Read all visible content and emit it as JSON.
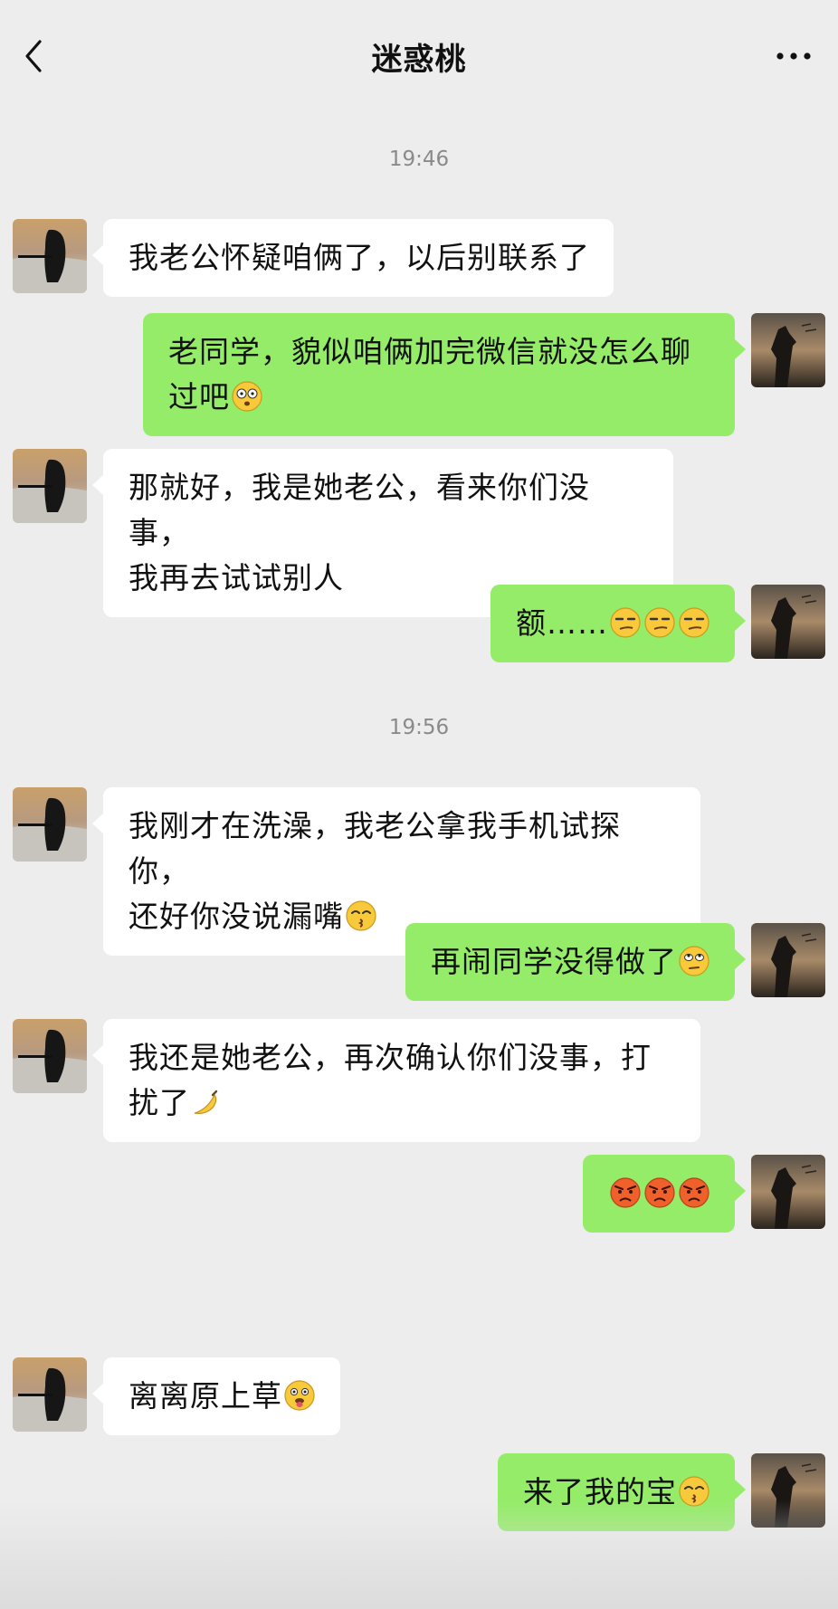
{
  "header": {
    "title": "迷惑桃",
    "back_icon": "chevron-left-icon",
    "more_icon": "more-dots-icon"
  },
  "colors": {
    "background": "#ededed",
    "incoming_bubble": "#ffffff",
    "outgoing_bubble": "#95ec69",
    "timestamp": "#8a8a8a"
  },
  "timestamps": [
    "19:46",
    "19:56"
  ],
  "messages": [
    {
      "side": "in",
      "lines": [
        "我老公怀疑咱俩了，以后别联系了"
      ]
    },
    {
      "side": "out",
      "line1": "老同学，貌似咱俩加完微信就没怎么聊",
      "line2": "过吧",
      "emoji": "shocked-face-icon"
    },
    {
      "side": "in",
      "line1": "那就好，我是她老公，看来你们没事，",
      "line2": "我再去试试别人"
    },
    {
      "side": "out",
      "text": "额……",
      "emojis": [
        "smirk-face-icon",
        "smirk-face-icon",
        "smirk-face-icon"
      ]
    },
    {
      "side": "in",
      "line1": "我刚才在洗澡，我老公拿我手机试探你，",
      "line2": "还好你没说漏嘴",
      "emoji": "kissing-face-icon"
    },
    {
      "side": "out",
      "text": "再闹同学没得做了",
      "emoji": "eye-roll-face-icon"
    },
    {
      "side": "in",
      "line1": "我还是她老公，再次确认你们没事，打",
      "line2": "扰了",
      "emoji": "banana-icon"
    },
    {
      "side": "out",
      "emojis": [
        "angry-face-icon",
        "angry-face-icon",
        "angry-face-icon"
      ]
    },
    {
      "side": "in",
      "text": "离离原上草",
      "emoji": "tongue-out-face-icon"
    },
    {
      "side": "out",
      "text": "来了我的宝",
      "emoji": "kissing-face-icon"
    }
  ]
}
